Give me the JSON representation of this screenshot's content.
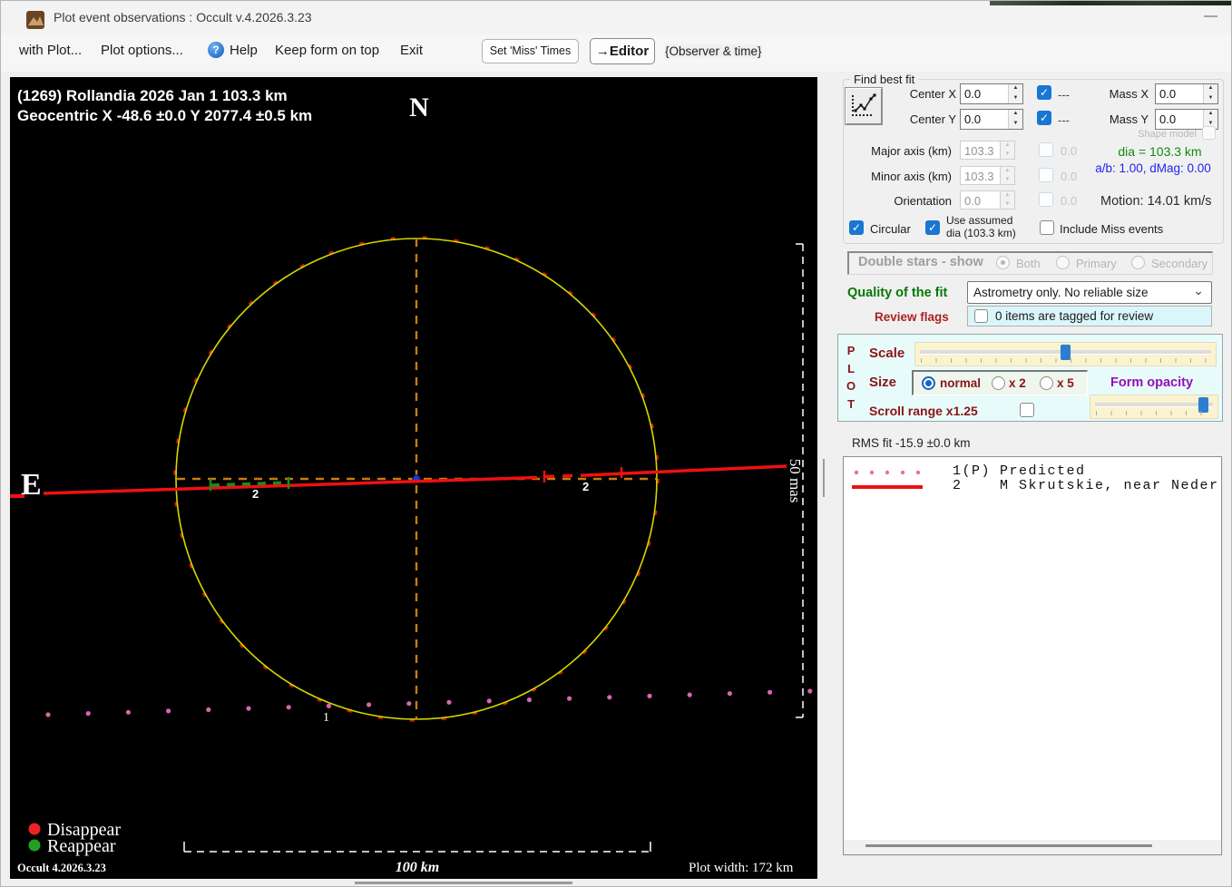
{
  "window": {
    "title": "Plot event observations : Occult v.4.2026.3.23"
  },
  "icons": {
    "help": "?",
    "minimize": "—",
    "check": "✓",
    "chevron_down": "⌄",
    "spin_up": "▲",
    "spin_down": "▼"
  },
  "menubar": {
    "items": [
      "with Plot...",
      "Plot options...",
      "Help",
      "Keep form on top",
      "Exit"
    ],
    "set_miss_times": "Set 'Miss' Times",
    "editor": "→Editor",
    "observer_time": "{Observer & time}"
  },
  "plot": {
    "header_line1": "(1269) Rollandia  2026 Jan 1   103.3 km",
    "header_line2": "Geocentric  X  -48.6 ±0.0  Y 2077.4 ±0.5 km",
    "north": "N",
    "east": "E",
    "vertical_scale": "50 mas",
    "horizontal_scale": "100 km",
    "plot_width": "Plot width: 172 km",
    "legend_disappear": "Disappear",
    "legend_reappear": "Reappear",
    "version": "Occult 4.2026.3.23",
    "label_1": "1",
    "label_2": "2",
    "colors": {
      "circle": "#d6d600",
      "crosshair": "#c87d0a",
      "chord": "#ee1111",
      "reappear": "#1c8a1c",
      "predicted_dots": "#d965ae",
      "center_dot": "#2238d0",
      "disappear_legend": "#ee2222",
      "reappear_legend": "#22a022"
    }
  },
  "find_best_fit": {
    "group_label": "Find best fit",
    "center_x": {
      "label": "Center X",
      "value": "0.0",
      "suffix": "---"
    },
    "center_y": {
      "label": "Center Y",
      "value": "0.0",
      "suffix": "---"
    },
    "mass_x": {
      "label": "Mass X",
      "value": "0.0"
    },
    "mass_y": {
      "label": "Mass Y",
      "value": "0.0"
    },
    "shape_model": "Shape model",
    "major_axis": {
      "label": "Major axis (km)",
      "value": "103.3",
      "suffix": "0.0"
    },
    "minor_axis": {
      "label": "Minor axis (km)",
      "value": "103.3",
      "suffix": "0.0"
    },
    "orientation": {
      "label": "Orientation",
      "value": "0.0",
      "suffix": "0.0"
    },
    "dia_text": "dia = 103.3 km",
    "ab_text": "a/b: 1.00, dMag: 0.00",
    "motion_text": "Motion: 14.01 km/s",
    "circular": "Circular",
    "use_assumed_line1": "Use assumed",
    "use_assumed_line2": "dia (103.3 km)",
    "include_miss": "Include Miss events"
  },
  "double_stars": {
    "label": "Double stars - show",
    "options": [
      "Both",
      "Primary",
      "Secondary"
    ],
    "selected": "Both"
  },
  "quality": {
    "label": "Quality of the fit",
    "value": "Astrometry only. No reliable size"
  },
  "review": {
    "label": "Review flags",
    "text": "0 items are tagged for review"
  },
  "plot_panel": {
    "letters": "P\nL\nO\nT",
    "scale": "Scale",
    "size": "Size",
    "size_options": [
      "normal",
      "x 2",
      "x 5"
    ],
    "size_selected": "normal",
    "form_opacity": "Form opacity",
    "scroll_range": "Scroll range x1.25"
  },
  "rms": "RMS fit -15.9 ±0.0 km",
  "observer_list": [
    {
      "num": "1(P)",
      "name": "Predicted"
    },
    {
      "num": "2",
      "name": "M Skrutskie, near Neder"
    }
  ]
}
